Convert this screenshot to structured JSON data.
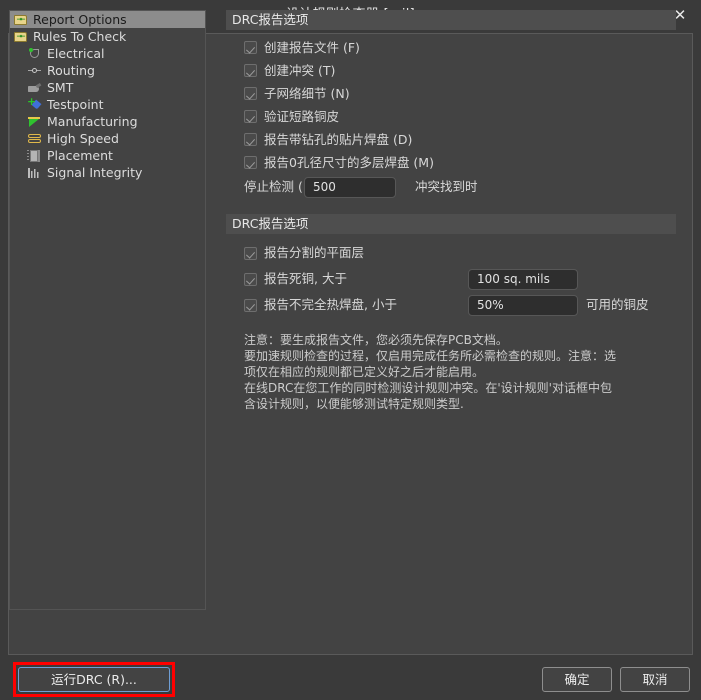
{
  "window": {
    "title": "设计规则检查器 [mil]",
    "close_label": "✕"
  },
  "sidebar": {
    "items": [
      {
        "label": "Report Options",
        "icon": "folder-icon",
        "level": 0,
        "selected": true
      },
      {
        "label": "Rules To Check",
        "icon": "folder-icon",
        "level": 0,
        "selected": false
      },
      {
        "label": "Electrical",
        "icon": "electrical-icon",
        "level": 1,
        "selected": false
      },
      {
        "label": "Routing",
        "icon": "routing-icon",
        "level": 1,
        "selected": false
      },
      {
        "label": "SMT",
        "icon": "smt-icon",
        "level": 1,
        "selected": false
      },
      {
        "label": "Testpoint",
        "icon": "testpoint-icon",
        "level": 1,
        "selected": false
      },
      {
        "label": "Manufacturing",
        "icon": "manufacturing-icon",
        "level": 1,
        "selected": false
      },
      {
        "label": "High Speed",
        "icon": "high-speed-icon",
        "level": 1,
        "selected": false
      },
      {
        "label": "Placement",
        "icon": "placement-icon",
        "level": 1,
        "selected": false
      },
      {
        "label": "Signal Integrity",
        "icon": "signal-integrity-icon",
        "level": 1,
        "selected": false
      }
    ]
  },
  "group1": {
    "header": "DRC报告选项",
    "checkboxes": [
      {
        "label": "创建报告文件 (F)",
        "checked": true
      },
      {
        "label": "创建冲突 (T)",
        "checked": true
      },
      {
        "label": "子网络细节 (N)",
        "checked": true
      },
      {
        "label": "验证短路铜皮",
        "checked": true
      },
      {
        "label": "报告带钻孔的贴片焊盘 (D)",
        "checked": true
      },
      {
        "label": "报告0孔径尺寸的多层焊盘 (M)",
        "checked": true
      }
    ],
    "stop_row": {
      "prefix": "停止检测 (E",
      "value": "500",
      "suffix": "冲突找到时"
    }
  },
  "group2": {
    "header": "DRC报告选项",
    "rows": [
      {
        "label": "报告分割的平面层",
        "checked": true,
        "value": null,
        "suffix": null
      },
      {
        "label": "报告死铜, 大于",
        "checked": true,
        "value": "100 sq. mils",
        "suffix": null
      },
      {
        "label": "报告不完全热焊盘, 小于",
        "checked": true,
        "value": "50%",
        "suffix": "可用的铜皮"
      }
    ]
  },
  "note": {
    "line1": "注意：要生成报告文件，您必须先保存PCB文档。",
    "line2": "要加速规则检查的过程，仅启用完成任务所必需检查的规则。注意：选",
    "line3": "项仅在相应的规则都已定义好之后才能启用。",
    "line4": "在线DRC在您工作的同时检测设计规则冲突。在'设计规则'对话框中包",
    "line5": "含设计规则，以便能够测试特定规则类型."
  },
  "footer": {
    "run_drc": "运行DRC (R)...",
    "ok": "确定",
    "cancel": "取消"
  },
  "colors": {
    "window_bg": "#3a3a3a",
    "panel_bg": "#434343",
    "group_header_bg": "#4e4e4e",
    "selection_bg": "#8c8c8c",
    "field_bg": "#2e2e2e",
    "highlight_red": "#ff0000",
    "focus_blue": "#6f9ed4"
  }
}
